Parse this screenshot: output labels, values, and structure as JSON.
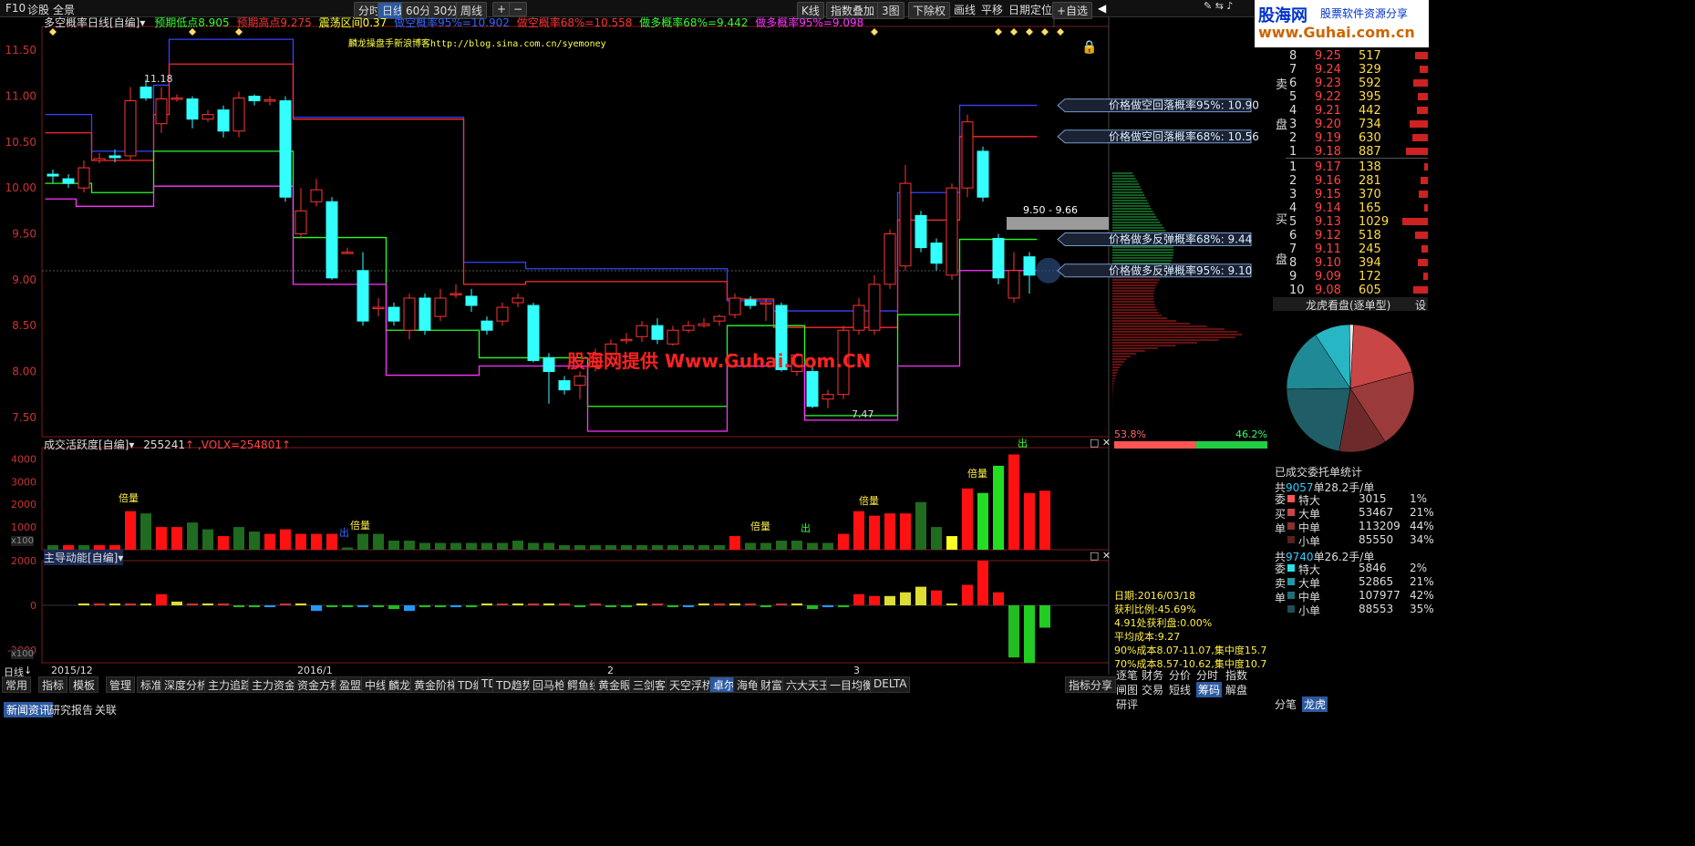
{
  "topbar": {
    "app_items": [
      "F10",
      "诊股",
      "全景"
    ],
    "period_buttons": [
      "分时",
      "日线",
      "60分",
      "30分",
      "周线"
    ],
    "active_period": "日线",
    "right_menu": [
      "K线",
      "指数叠加",
      "3图",
      "下除权",
      "画线",
      "平移",
      "日期定位",
      "+自选"
    ]
  },
  "indicator_header": {
    "name": "多空概率日线[自编]",
    "items": [
      {
        "text": "预期低点8.905",
        "color": "#33ff33"
      },
      {
        "text": "预期高点9.275",
        "color": "#ff3333"
      },
      {
        "text": "震荡区间0.37",
        "color": "#ffff33"
      },
      {
        "text": "做空概率95%=10.902",
        "color": "#3366ff"
      },
      {
        "text": "做空概率68%=10.558",
        "color": "#ff3333"
      },
      {
        "text": "做多概率68%=9.442",
        "color": "#33ff33"
      },
      {
        "text": "做多概率95%=9.098",
        "color": "#ff33ff"
      }
    ]
  },
  "blog_text": "麟龙操盘手新浪博客http://blog.sina.com.cn/syemoney",
  "watermark": "股海网提供 Www.Guhai.Com.CN",
  "logo": {
    "title": "股海网",
    "subtitle": "股票软件资源分享",
    "url": "www.Guhai.com.cn"
  },
  "price_labels": [
    {
      "text": "价格做空回落概率95%: 10.90",
      "value": 10.9
    },
    {
      "text": "价格做空回落概率68%: 10.56",
      "value": 10.56
    },
    {
      "text": "价格做多反弹概率68%: 9.44",
      "value": 9.44
    },
    {
      "text": "价格做多反弹概率95%: 9.10",
      "value": 9.1
    }
  ],
  "range_label": "9.50 - 9.66",
  "high_label": "11.18",
  "low_label": "7.47",
  "volume_header": {
    "name": "成交活跃度[自编]",
    "value": "255241",
    "volx": ",VOLX=254801"
  },
  "volume_tags": [
    "倍量",
    "倍量",
    "倍量",
    "倍量",
    "倍量",
    "出",
    "出",
    "出"
  ],
  "flow_header": {
    "name": "主导动能[自编]"
  },
  "x100": "x100",
  "date_axis": [
    "2015/12",
    "2016/1",
    "2",
    "3"
  ],
  "date_axis_label": "日线",
  "bottom_tabs": [
    "常用",
    "指标",
    "模板",
    "管理",
    "标准",
    "深度分析",
    "主力追踪",
    "主力资金",
    "资金方程",
    "盈盟",
    "中线",
    "麟龙",
    "黄金阶梯",
    "TD缠",
    "TD",
    "TD趋势",
    "回马枪",
    "鳄鱼线",
    "黄金眼",
    "三剑客",
    "天空浮桥",
    "卓尔",
    "海龟",
    "财富",
    "六大天王",
    "一目均衡",
    "DELTA"
  ],
  "active_bottom_tab": "卓尔",
  "right_bottom_tab": "指标分享",
  "news_tabs": [
    "新闻资讯",
    "研究报告",
    "关联"
  ],
  "orderbook": {
    "sell_label": "卖盘",
    "buy_label": "买盘",
    "sell": [
      {
        "lvl": "8",
        "price": "9.25",
        "vol": "517"
      },
      {
        "lvl": "7",
        "price": "9.24",
        "vol": "329"
      },
      {
        "lvl": "6",
        "price": "9.23",
        "vol": "592"
      },
      {
        "lvl": "5",
        "price": "9.22",
        "vol": "395"
      },
      {
        "lvl": "4",
        "price": "9.21",
        "vol": "442"
      },
      {
        "lvl": "3",
        "price": "9.20",
        "vol": "734"
      },
      {
        "lvl": "2",
        "price": "9.19",
        "vol": "630"
      },
      {
        "lvl": "1",
        "price": "9.18",
        "vol": "887"
      }
    ],
    "buy": [
      {
        "lvl": "1",
        "price": "9.17",
        "vol": "138"
      },
      {
        "lvl": "2",
        "price": "9.16",
        "vol": "281"
      },
      {
        "lvl": "3",
        "price": "9.15",
        "vol": "370"
      },
      {
        "lvl": "4",
        "price": "9.14",
        "vol": "165"
      },
      {
        "lvl": "5",
        "price": "9.13",
        "vol": "1029"
      },
      {
        "lvl": "6",
        "price": "9.12",
        "vol": "518"
      },
      {
        "lvl": "7",
        "price": "9.11",
        "vol": "245"
      },
      {
        "lvl": "8",
        "price": "9.10",
        "vol": "394"
      },
      {
        "lvl": "9",
        "price": "9.09",
        "vol": "172"
      },
      {
        "lvl": "10",
        "price": "9.08",
        "vol": "605"
      }
    ]
  },
  "dragon_panel": {
    "title": "龙虎看盘(逐单型)",
    "settings": "设"
  },
  "pie": [
    {
      "pct": 20,
      "color": "#c84646"
    },
    {
      "pct": 20,
      "color": "#9a3a3a"
    },
    {
      "pct": 12,
      "color": "#6e2a2a"
    },
    {
      "pct": 22,
      "color": "#1f5e66"
    },
    {
      "pct": 16,
      "color": "#1f8a95"
    },
    {
      "pct": 9,
      "color": "#27b6c4"
    },
    {
      "pct": 1,
      "color": "#e8e8e8"
    }
  ],
  "split_bar": {
    "left": "53.8%",
    "right": "46.2%",
    "left_frac": 0.538
  },
  "order_stats": {
    "title": "已成交委托单统计",
    "buy_label": "委买单",
    "sell_label": "委卖单",
    "buy_summary": [
      "共",
      "9057",
      "单",
      "28.2手/单"
    ],
    "sell_summary": [
      "共",
      "9740",
      "单",
      "26.2手/单"
    ],
    "buy_rows": [
      {
        "name": "特大",
        "vol": "3015",
        "pct": "1%",
        "color": "#ff5555"
      },
      {
        "name": "大单",
        "vol": "53467",
        "pct": "21%",
        "color": "#c84646"
      },
      {
        "name": "中单",
        "vol": "113209",
        "pct": "44%",
        "color": "#8a3030"
      },
      {
        "name": "小单",
        "vol": "85550",
        "pct": "34%",
        "color": "#5a2020"
      }
    ],
    "sell_rows": [
      {
        "name": "特大",
        "vol": "5846",
        "pct": "2%",
        "color": "#27e0f0"
      },
      {
        "name": "大单",
        "vol": "52865",
        "pct": "21%",
        "color": "#1f9aa5"
      },
      {
        "name": "中单",
        "vol": "107977",
        "pct": "42%",
        "color": "#1f6e76"
      },
      {
        "name": "小单",
        "vol": "88553",
        "pct": "35%",
        "color": "#1f4e56"
      }
    ]
  },
  "chip_info": [
    "日期:2016/03/18",
    "获利比例:45.69%",
    "4.91处获利盘:0.00%",
    "平均成本:9.27",
    "90%成本8.07-11.07,集中度15.7",
    "70%成本8.57-10.62,集中度10.7"
  ],
  "right_tabs_row1": [
    "逐笔",
    "财务",
    "分价",
    "分时",
    "指数"
  ],
  "right_tabs_row2": [
    "闸图",
    "交易",
    "短线",
    "筹码",
    "解盘"
  ],
  "active_right_tab": "筹码",
  "right_tabs_row3": [
    "研评"
  ],
  "bottom_right_tabs": [
    "分笔",
    "龙虎"
  ],
  "active_bottom_right": "龙虎",
  "chart_data": {
    "type": "candlestick",
    "y_ticks": [
      11.5,
      11.0,
      10.5,
      10.0,
      9.5,
      9.0,
      8.5,
      8.0,
      7.5
    ],
    "ylim": [
      7.3,
      11.75
    ],
    "candles": [
      [
        10.15,
        10.13,
        10.2,
        10.05
      ],
      [
        10.1,
        10.05,
        10.15,
        10.0
      ],
      [
        10.0,
        10.22,
        10.3,
        9.95
      ],
      [
        10.3,
        10.32,
        10.38,
        10.27
      ],
      [
        10.35,
        10.33,
        10.42,
        10.28
      ],
      [
        10.35,
        10.95,
        11.1,
        10.3
      ],
      [
        11.1,
        10.98,
        11.18,
        10.95
      ],
      [
        10.7,
        10.97,
        11.1,
        10.6
      ],
      [
        10.98,
        10.98,
        11.02,
        10.94
      ],
      [
        10.97,
        10.75,
        11.0,
        10.65
      ],
      [
        10.75,
        10.8,
        10.85,
        10.72
      ],
      [
        10.85,
        10.62,
        10.9,
        10.55
      ],
      [
        10.62,
        10.98,
        11.05,
        10.55
      ],
      [
        11.0,
        10.95,
        11.02,
        10.9
      ],
      [
        10.95,
        10.96,
        11.0,
        10.9
      ],
      [
        10.95,
        9.9,
        11.0,
        9.85
      ],
      [
        9.5,
        9.75,
        10.0,
        9.45
      ],
      [
        9.85,
        9.98,
        10.1,
        9.8
      ],
      [
        9.85,
        9.02,
        9.9,
        9.0
      ],
      [
        9.3,
        9.3,
        9.35,
        9.28
      ],
      [
        9.1,
        8.55,
        9.3,
        8.5
      ],
      [
        8.7,
        8.7,
        8.8,
        8.6
      ],
      [
        8.7,
        8.55,
        8.75,
        8.5
      ],
      [
        8.45,
        8.8,
        8.85,
        8.35
      ],
      [
        8.8,
        8.45,
        8.85,
        8.4
      ],
      [
        8.6,
        8.8,
        8.9,
        8.55
      ],
      [
        8.85,
        8.85,
        8.95,
        8.8
      ],
      [
        8.82,
        8.72,
        8.9,
        8.65
      ],
      [
        8.55,
        8.45,
        8.6,
        8.4
      ],
      [
        8.55,
        8.7,
        8.75,
        8.5
      ],
      [
        8.75,
        8.8,
        8.85,
        8.7
      ],
      [
        8.72,
        8.12,
        8.75,
        8.1
      ],
      [
        8.15,
        8.0,
        8.2,
        7.65
      ],
      [
        7.9,
        7.8,
        7.95,
        7.75
      ],
      [
        7.85,
        7.95,
        8.0,
        7.7
      ],
      [
        8.05,
        8.2,
        8.25,
        8.0
      ],
      [
        8.2,
        8.3,
        8.35,
        8.15
      ],
      [
        8.35,
        8.35,
        8.42,
        8.3
      ],
      [
        8.38,
        8.5,
        8.55,
        8.32
      ],
      [
        8.5,
        8.35,
        8.58,
        8.3
      ],
      [
        8.3,
        8.45,
        8.5,
        8.28
      ],
      [
        8.45,
        8.5,
        8.55,
        8.42
      ],
      [
        8.5,
        8.52,
        8.58,
        8.48
      ],
      [
        8.55,
        8.6,
        8.62,
        8.5
      ],
      [
        8.62,
        8.8,
        8.85,
        8.58
      ],
      [
        8.78,
        8.72,
        8.82,
        8.68
      ],
      [
        8.75,
        8.75,
        8.8,
        8.55
      ],
      [
        8.72,
        8.02,
        8.75,
        8.0
      ],
      [
        8.0,
        8.18,
        8.2,
        7.95
      ],
      [
        8.0,
        7.62,
        8.05,
        7.6
      ],
      [
        7.7,
        7.75,
        7.8,
        7.6
      ],
      [
        7.75,
        8.45,
        8.5,
        7.7
      ],
      [
        8.45,
        8.72,
        8.8,
        8.4
      ],
      [
        8.45,
        8.95,
        9.05,
        8.4
      ],
      [
        8.95,
        9.5,
        9.55,
        8.9
      ],
      [
        9.15,
        10.05,
        10.25,
        9.1
      ],
      [
        9.7,
        9.35,
        9.75,
        9.3
      ],
      [
        9.4,
        9.18,
        9.45,
        9.1
      ],
      [
        9.05,
        10.0,
        10.05,
        9.0
      ],
      [
        10.0,
        10.72,
        10.8,
        9.9
      ],
      [
        10.4,
        9.9,
        10.45,
        9.85
      ],
      [
        9.45,
        9.02,
        9.5,
        8.95
      ],
      [
        8.8,
        9.1,
        9.3,
        8.75
      ],
      [
        9.25,
        9.05,
        9.3,
        8.85
      ]
    ],
    "band_short95": [
      10.8,
      10.8,
      10.8,
      10.4,
      10.4,
      10.4,
      10.4,
      11.12,
      11.62,
      11.62,
      11.62,
      11.62,
      11.62,
      11.62,
      11.62,
      11.62,
      10.77,
      10.77,
      10.77,
      10.77,
      10.77,
      10.77,
      10.77,
      10.77,
      10.77,
      10.77,
      10.77,
      9.19,
      9.19,
      9.19,
      9.19,
      9.12,
      9.12,
      9.12,
      9.12,
      9.12,
      9.12,
      9.12,
      9.12,
      9.12,
      9.12,
      9.12,
      9.12,
      9.12,
      8.77,
      8.77,
      8.77,
      8.66,
      8.66,
      8.66,
      8.66,
      8.66,
      8.66,
      8.66,
      8.66,
      9.95,
      9.95,
      9.95,
      9.95,
      10.9,
      10.9,
      10.9,
      10.9,
      10.9
    ],
    "band_short68": [
      10.6,
      10.6,
      10.6,
      10.3,
      10.3,
      10.3,
      10.3,
      10.8,
      11.35,
      11.35,
      11.35,
      11.35,
      11.35,
      11.35,
      11.35,
      11.35,
      10.75,
      10.75,
      10.75,
      10.75,
      10.75,
      10.75,
      10.75,
      10.75,
      10.75,
      10.75,
      10.75,
      8.95,
      8.95,
      8.95,
      8.95,
      8.98,
      8.98,
      8.98,
      8.98,
      8.98,
      8.98,
      8.98,
      8.98,
      8.98,
      8.98,
      8.98,
      8.98,
      8.98,
      8.79,
      8.79,
      8.79,
      8.48,
      8.48,
      8.48,
      8.48,
      8.48,
      8.48,
      8.48,
      8.48,
      9.65,
      9.65,
      9.65,
      9.65,
      10.56,
      10.56,
      10.56,
      10.56,
      10.56
    ],
    "band_long68": [
      10.05,
      10.05,
      10.05,
      9.95,
      9.95,
      9.95,
      9.95,
      10.4,
      10.4,
      10.4,
      10.4,
      10.4,
      10.4,
      10.4,
      10.4,
      10.4,
      9.46,
      9.46,
      9.46,
      9.46,
      9.46,
      9.46,
      8.45,
      8.45,
      8.45,
      8.45,
      8.45,
      8.45,
      8.15,
      8.15,
      8.15,
      8.15,
      8.15,
      8.15,
      8.15,
      7.62,
      7.62,
      7.62,
      7.62,
      7.62,
      7.62,
      7.62,
      7.62,
      7.62,
      8.5,
      8.5,
      8.5,
      8.5,
      8.5,
      7.52,
      7.52,
      7.52,
      7.52,
      7.52,
      7.52,
      8.62,
      8.62,
      8.62,
      8.62,
      9.44,
      9.44,
      9.44,
      9.44,
      9.44
    ],
    "band_long95": [
      9.88,
      9.88,
      9.8,
      9.8,
      9.8,
      9.8,
      9.8,
      10.02,
      10.02,
      10.02,
      10.02,
      10.02,
      10.02,
      10.02,
      10.02,
      10.02,
      8.95,
      8.95,
      8.95,
      8.95,
      8.95,
      8.95,
      7.96,
      7.96,
      7.96,
      7.96,
      7.96,
      7.96,
      8.06,
      8.06,
      8.06,
      8.06,
      8.06,
      8.06,
      8.06,
      7.35,
      7.35,
      7.35,
      7.35,
      7.35,
      7.35,
      7.35,
      7.35,
      7.35,
      8.06,
      8.06,
      8.06,
      8.06,
      8.06,
      7.47,
      7.47,
      7.47,
      7.47,
      7.47,
      7.47,
      8.06,
      8.06,
      8.06,
      8.06,
      9.1,
      9.1,
      9.1,
      9.1,
      9.1
    ],
    "volume": [
      2,
      2,
      2,
      2,
      2,
      17,
      16,
      10,
      10,
      12,
      9,
      6,
      10,
      8,
      7,
      9,
      7,
      7,
      7,
      1,
      7,
      7,
      4,
      4,
      3,
      3,
      3,
      3,
      3,
      3,
      4,
      3,
      3,
      2,
      2,
      2,
      2,
      2,
      2,
      2,
      2,
      2,
      2,
      2,
      6,
      3,
      3,
      4,
      4,
      3,
      3,
      7,
      17,
      15,
      16,
      16,
      21,
      10,
      6,
      27,
      25,
      37,
      42,
      25,
      26
    ],
    "volume_colors": [
      "g",
      "r",
      "g",
      "r",
      "r",
      "r",
      "g",
      "r",
      "r",
      "g",
      "g",
      "r",
      "g",
      "g",
      "r",
      "r",
      "r",
      "r",
      "r",
      "g",
      "g",
      "g",
      "g",
      "g",
      "g",
      "g",
      "g",
      "g",
      "g",
      "g",
      "g",
      "g",
      "g",
      "g",
      "g",
      "g",
      "g",
      "g",
      "g",
      "g",
      "g",
      "g",
      "g",
      "g",
      "r",
      "g",
      "g",
      "g",
      "g",
      "g",
      "g",
      "r",
      "r",
      "r",
      "r",
      "r",
      "g",
      "g",
      "y",
      "r",
      "G",
      "G",
      "r",
      "r",
      "r"
    ],
    "flow": [
      1,
      1,
      1,
      1,
      1,
      6,
      2,
      1,
      1,
      1,
      -1,
      -1,
      -1,
      1,
      1,
      -3,
      -1,
      -1,
      -1,
      -1,
      -2,
      -3,
      -1,
      -1,
      -1,
      -1,
      1,
      1,
      1,
      1,
      1,
      1,
      -1,
      1,
      -1,
      -1,
      1,
      1,
      -1,
      -1,
      1,
      1,
      1,
      1,
      -1,
      1,
      1,
      -2,
      -1,
      -1,
      6,
      5,
      5,
      7,
      10,
      8,
      1,
      11,
      24,
      7,
      -28,
      -31,
      -12
    ]
  }
}
